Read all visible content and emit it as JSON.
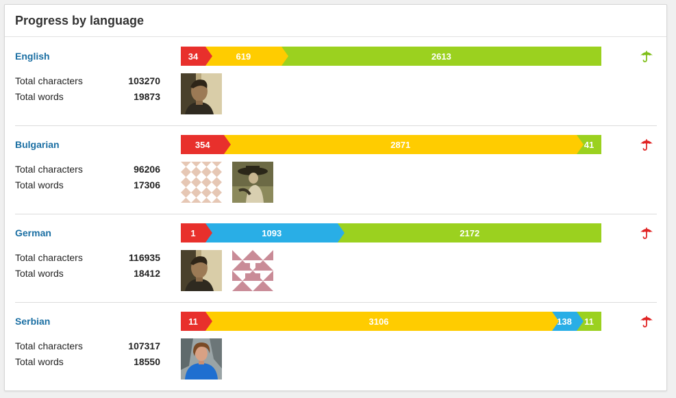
{
  "panel": {
    "title": "Progress by language"
  },
  "colors": {
    "red": "#e8302c",
    "yellow": "#ffcc00",
    "blue": "#29aee6",
    "green": "#9bd11f",
    "umbrella_green": "#7fbf1a",
    "umbrella_red": "#e02424"
  },
  "labels": {
    "total_characters": "Total characters",
    "total_words": "Total words"
  },
  "languages": [
    {
      "name": "English",
      "total_characters": "103270",
      "total_words": "19873",
      "umbrella": "green",
      "segments": [
        {
          "value": 34,
          "label": "34",
          "color": "red"
        },
        {
          "value": 619,
          "label": "619",
          "color": "yellow"
        },
        {
          "value": 2613,
          "label": "2613",
          "color": "green"
        }
      ],
      "avatars": [
        "photo-avatar-man"
      ]
    },
    {
      "name": "Bulgarian",
      "total_characters": "96206",
      "total_words": "17306",
      "umbrella": "red",
      "segments": [
        {
          "value": 354,
          "label": "354",
          "color": "red"
        },
        {
          "value": 2871,
          "label": "2871",
          "color": "yellow"
        },
        {
          "value": 41,
          "label": "41",
          "color": "green"
        }
      ],
      "avatars": [
        "identicon-peach",
        "photo-avatar-woman-hat"
      ]
    },
    {
      "name": "German",
      "total_characters": "116935",
      "total_words": "18412",
      "umbrella": "red",
      "segments": [
        {
          "value": 1,
          "label": "1",
          "color": "red"
        },
        {
          "value": 1093,
          "label": "1093",
          "color": "blue"
        },
        {
          "value": 2172,
          "label": "2172",
          "color": "green"
        }
      ],
      "avatars": [
        "photo-avatar-man",
        "identicon-mauve"
      ]
    },
    {
      "name": "Serbian",
      "total_characters": "107317",
      "total_words": "18550",
      "umbrella": "red",
      "segments": [
        {
          "value": 11,
          "label": "11",
          "color": "red"
        },
        {
          "value": 3106,
          "label": "3106",
          "color": "yellow"
        },
        {
          "value": 138,
          "label": "138",
          "color": "blue"
        },
        {
          "value": 11,
          "label": "11",
          "color": "green"
        }
      ],
      "avatars": [
        "photo-avatar-blue-jacket"
      ]
    }
  ]
}
